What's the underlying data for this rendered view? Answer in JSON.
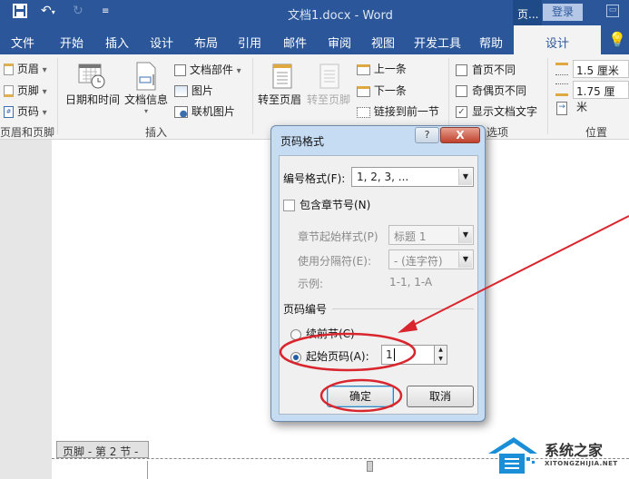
{
  "titlebar": {
    "title": "文档1.docx  -  Word",
    "context_label": "页...",
    "login_label": "登录",
    "qat_icons": [
      "save-icon",
      "undo-icon",
      "redo-icon",
      "customize-qat-icon"
    ]
  },
  "tabs": [
    {
      "label": "文件"
    },
    {
      "label": "开始"
    },
    {
      "label": "插入"
    },
    {
      "label": "设计"
    },
    {
      "label": "布局"
    },
    {
      "label": "引用"
    },
    {
      "label": "邮件"
    },
    {
      "label": "审阅"
    },
    {
      "label": "视图"
    },
    {
      "label": "开发工具"
    },
    {
      "label": "帮助"
    },
    {
      "label": "设计",
      "active": true
    }
  ],
  "ribbon": {
    "header_footer": {
      "items": [
        "页眉",
        "页脚",
        "页码"
      ],
      "group_label": "页眉和页脚"
    },
    "insert": {
      "date_time": "日期和时间",
      "doc_info": "文档信息",
      "doc_parts": "文档部件",
      "picture": "图片",
      "online_picture": "联机图片",
      "group_label": "插入"
    },
    "navigation": {
      "goto_header": "转至页眉",
      "goto_footer": "转至页脚",
      "previous": "上一条",
      "next": "下一条",
      "link_previous": "链接到前一节"
    },
    "options": {
      "different_first": "首页不同",
      "different_odd_even": "奇偶页不同",
      "show_doc_text": "显示文档文字",
      "show_doc_text_checked": true,
      "group_label": "选项"
    },
    "position": {
      "header_from_top": "1.5 厘米",
      "footer_from_bottom": "1.75 厘米",
      "group_label": "位置"
    }
  },
  "document": {
    "footer_tag": "页脚 - 第 2 节 -"
  },
  "dialog": {
    "title": "页码格式",
    "help_label": "?",
    "close_label": "X",
    "number_format_label": "编号格式(F):",
    "number_format_value": "1, 2, 3, ...",
    "include_chapter_label": "包含章节号(N)",
    "chapter_style_label": "章节起始样式(P)",
    "chapter_style_value": "标题 1",
    "separator_label": "使用分隔符(E):",
    "separator_value": "-  (连字符)",
    "example_label": "示例:",
    "example_value": "1-1, 1-A",
    "page_numbering_label": "页码编号",
    "continue_label": "续前节(C)",
    "start_at_label": "起始页码(A):",
    "start_at_value": "1",
    "ok_label": "确定",
    "cancel_label": "取消"
  },
  "watermark": {
    "text": "系统之家",
    "url": "XITONGZHIJIA.NET"
  },
  "annotation_color": "#d9262e"
}
